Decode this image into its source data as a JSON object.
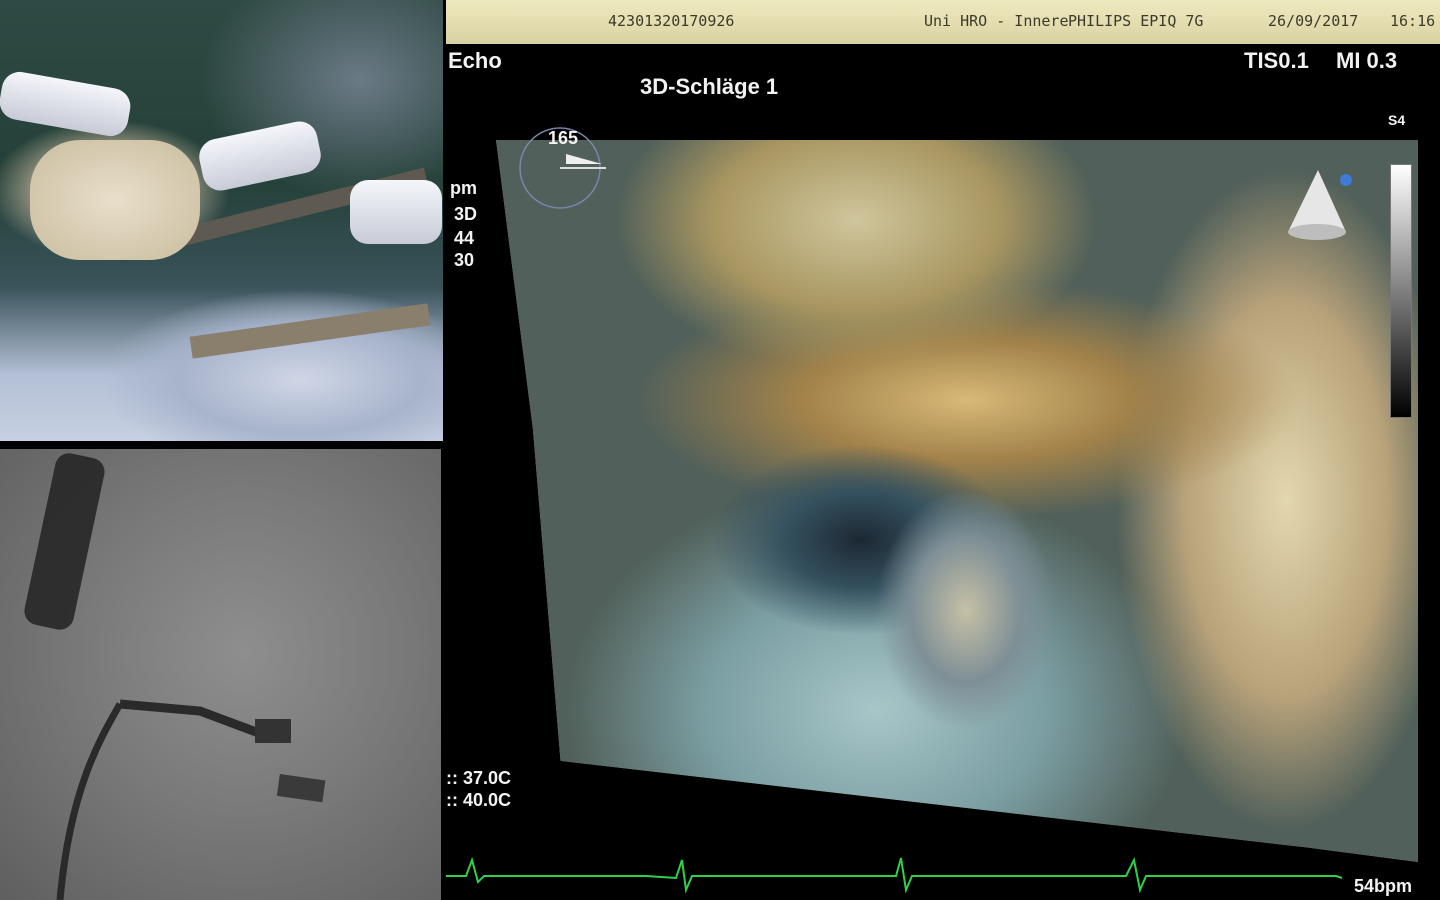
{
  "echo": {
    "header": {
      "patient_id": "42301320170926",
      "institution": "Uni HRO - Innere",
      "device": "PHILIPS  EPIQ 7G",
      "date": "26/09/2017",
      "time": "16:16"
    },
    "mode_label": "Echo",
    "title": "3D-Schläge 1",
    "tis": "TIS0.1",
    "mi": "MI 0.3",
    "probe": "S4",
    "angle": "165",
    "side_labels": [
      "pm",
      "3D",
      "44",
      "30"
    ],
    "temperatures": [
      ":: 37.0C",
      ":: 40.0C"
    ],
    "heart_rate": "54bpm"
  },
  "colors": {
    "ecg": "#2fd14a",
    "header_bg": "#e6dfb2",
    "probe_dot": "#3e7bd8"
  }
}
